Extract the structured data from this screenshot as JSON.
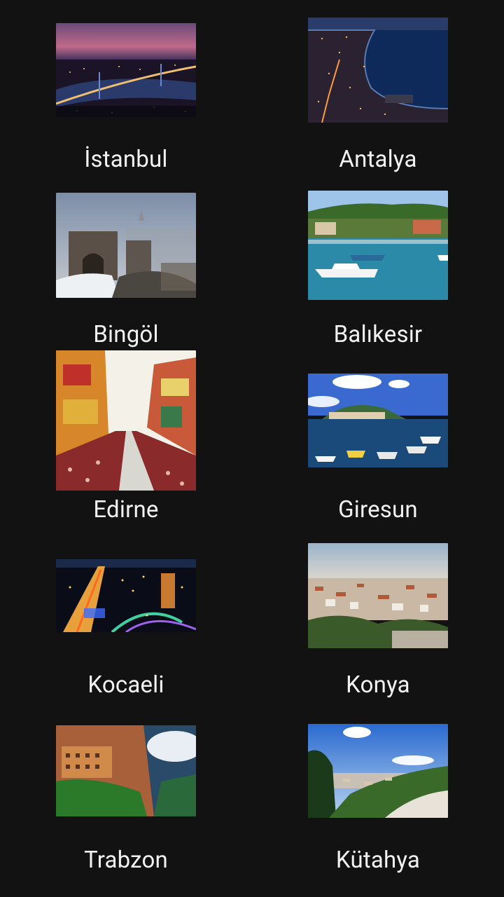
{
  "cities": [
    {
      "name": "İstanbul",
      "image": "istanbul-bosphorus-bridge-night-photo"
    },
    {
      "name": "Antalya",
      "image": "antalya-coast-aerial-night-photo"
    },
    {
      "name": "Bingöl",
      "image": "bingol-castle-winter-photo"
    },
    {
      "name": "Balıkesir",
      "image": "balikesir-harbor-boats-photo"
    },
    {
      "name": "Edirne",
      "image": "edirne-colorful-street-photo"
    },
    {
      "name": "Giresun",
      "image": "giresun-harbor-boats-photo"
    },
    {
      "name": "Kocaeli",
      "image": "kocaeli-city-night-lights-photo"
    },
    {
      "name": "Konya",
      "image": "konya-cityscape-photo"
    },
    {
      "name": "Trabzon",
      "image": "trabzon-sumela-monastery-photo"
    },
    {
      "name": "Kütahya",
      "image": "kutahya-hills-panorama-photo"
    }
  ]
}
